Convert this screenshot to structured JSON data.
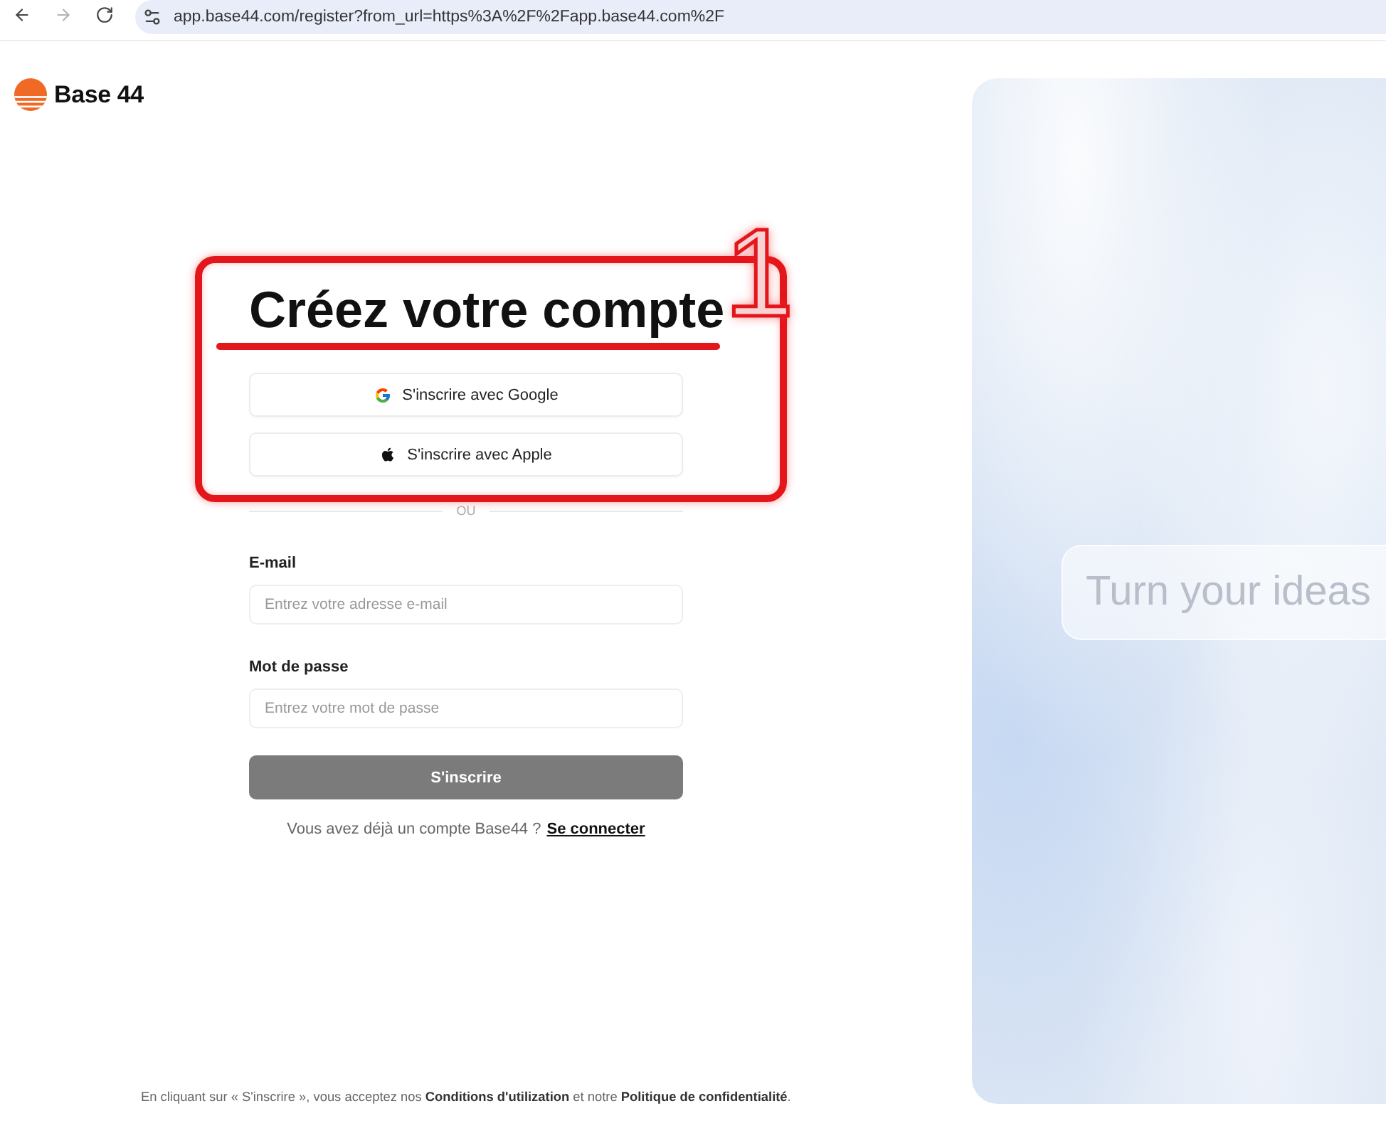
{
  "browser": {
    "url": "app.base44.com/register?from_url=https%3A%2F%2Fapp.base44.com%2F",
    "forward_disabled": true
  },
  "logo": {
    "text": "Base 44"
  },
  "form": {
    "title": "Créez votre compte",
    "social_buttons": [
      {
        "kind": "google",
        "label": "S'inscrire avec Google"
      },
      {
        "kind": "apple",
        "label": "S'inscrire avec Apple"
      }
    ],
    "separator": "OU",
    "fields": [
      {
        "label": "E-mail",
        "placeholder": "Entrez votre adresse e-mail"
      },
      {
        "label": "Mot de passe",
        "placeholder": "Entrez votre mot de passe"
      }
    ],
    "submit": {
      "label": "S'inscrire",
      "disabled": true
    },
    "login_prompt": "Vous avez déjà un compte Base44 ?",
    "login_link": "Se connecter"
  },
  "annotation": {
    "number": "1"
  },
  "legal": {
    "before": "En cliquant sur « S'inscrire », vous acceptez nos",
    "terms_link": "Conditions d'utilization",
    "middle": "et notre",
    "privacy_link": "Politique de confidentialité",
    "after": "."
  },
  "hero": {
    "prompt": "Turn your ideas"
  }
}
